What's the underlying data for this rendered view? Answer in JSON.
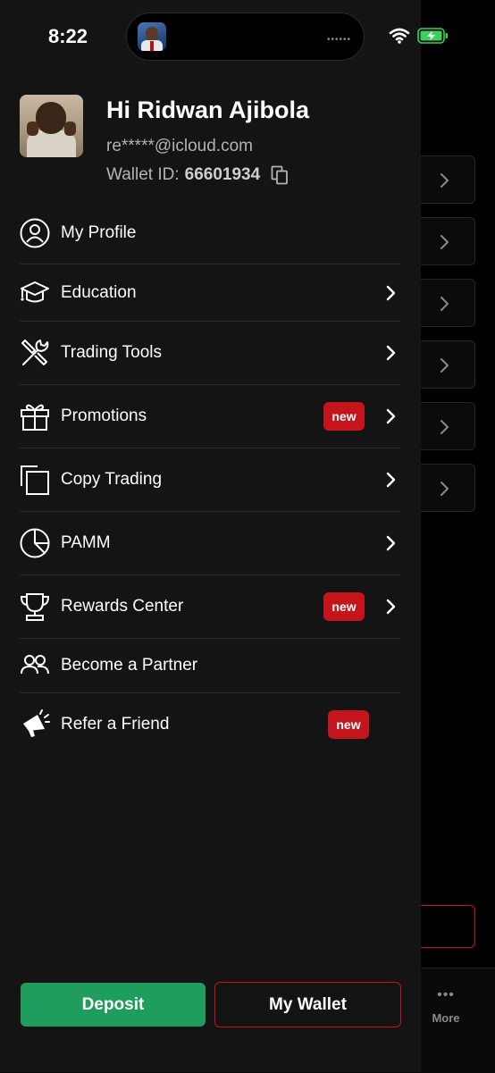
{
  "status_bar": {
    "time": "8:22",
    "island_dots": "••••••"
  },
  "profile": {
    "greeting": "Hi Ridwan Ajibola",
    "email": "re*****@icloud.com",
    "wallet_label": "Wallet ID:",
    "wallet_id": "66601934"
  },
  "menu": [
    {
      "label": "My Profile",
      "icon": "user-circle-icon",
      "badge": null,
      "chevron": false
    },
    {
      "label": "Education",
      "icon": "graduation-cap-icon",
      "badge": null,
      "chevron": true
    },
    {
      "label": "Trading Tools",
      "icon": "tools-icon",
      "badge": null,
      "chevron": true
    },
    {
      "label": "Promotions",
      "icon": "gift-icon",
      "badge": "new",
      "chevron": true
    },
    {
      "label": "Copy Trading",
      "icon": "copy-trading-icon",
      "badge": null,
      "chevron": true
    },
    {
      "label": "PAMM",
      "icon": "pie-chart-icon",
      "badge": null,
      "chevron": true
    },
    {
      "label": "Rewards Center",
      "icon": "trophy-icon",
      "badge": "new",
      "chevron": true
    },
    {
      "label": "Become a Partner",
      "icon": "users-icon",
      "badge": null,
      "chevron": false
    },
    {
      "label": "Refer a Friend",
      "icon": "megaphone-icon",
      "badge": "new",
      "chevron": false
    }
  ],
  "buttons": {
    "deposit": "Deposit",
    "wallet": "My Wallet"
  },
  "background_tabbar": {
    "more_label": "More",
    "more_dots": "•••"
  },
  "colors": {
    "accent_red": "#c4141c",
    "deposit_green": "#1f9d5c",
    "drawer_bg": "#141414"
  }
}
